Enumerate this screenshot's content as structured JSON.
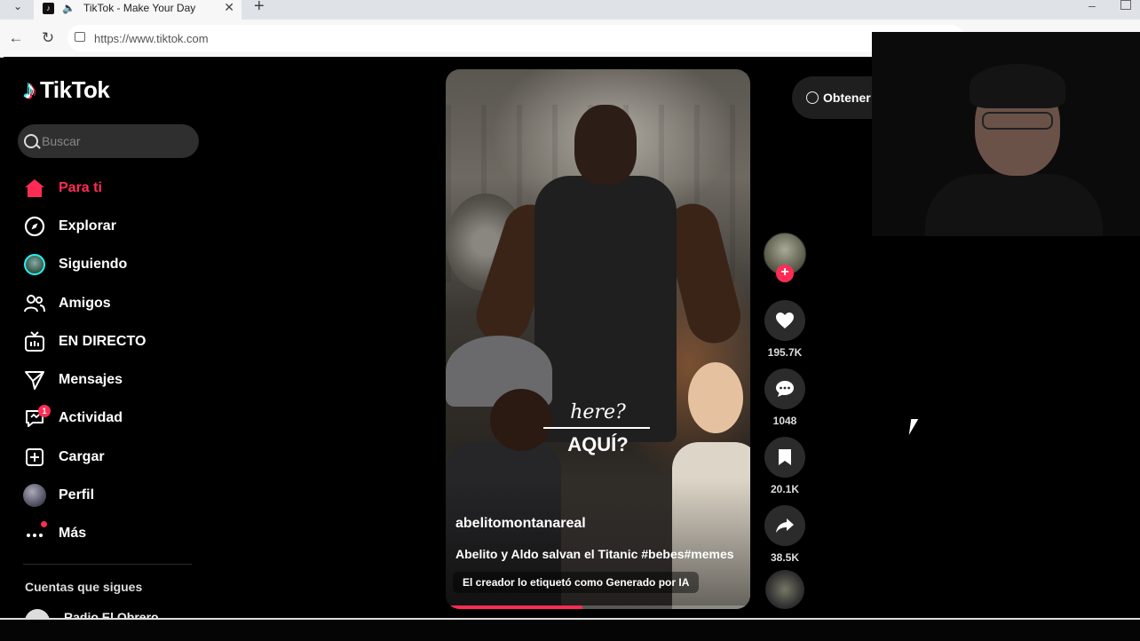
{
  "browser": {
    "tab_title": "TikTok - Make Your Day",
    "url": "https://www.tiktok.com"
  },
  "sidebar": {
    "logo_text": "TikTok",
    "search_placeholder": "Buscar",
    "items": [
      {
        "label": "Para ti",
        "icon": "home-icon",
        "active": true
      },
      {
        "label": "Explorar",
        "icon": "compass-icon"
      },
      {
        "label": "Siguiendo",
        "icon": "following-avatar-icon"
      },
      {
        "label": "Amigos",
        "icon": "friends-icon"
      },
      {
        "label": "EN DIRECTO",
        "icon": "live-tv-icon"
      },
      {
        "label": "Mensajes",
        "icon": "send-icon"
      },
      {
        "label": "Actividad",
        "icon": "activity-icon",
        "badge": "1"
      },
      {
        "label": "Cargar",
        "icon": "upload-icon"
      },
      {
        "label": "Perfil",
        "icon": "profile-avatar-icon"
      },
      {
        "label": "Más",
        "icon": "more-dots-icon"
      }
    ],
    "following_title": "Cuentas que sigues",
    "following_first": "Radio El Obrero"
  },
  "video": {
    "overlay_text_1": "here?",
    "overlay_text_2": "AQUÍ?",
    "author": "abelitomontanareal",
    "description": "Abelito y Aldo salvan el Titanic #bebes#memes",
    "ai_label": "El creador lo etiquetó como Generado por IA",
    "progress": 0.45
  },
  "actions": {
    "likes": "195.7K",
    "comments": "1048",
    "saves": "20.1K",
    "shares": "38.5K"
  },
  "get_app_label": "Obtener"
}
